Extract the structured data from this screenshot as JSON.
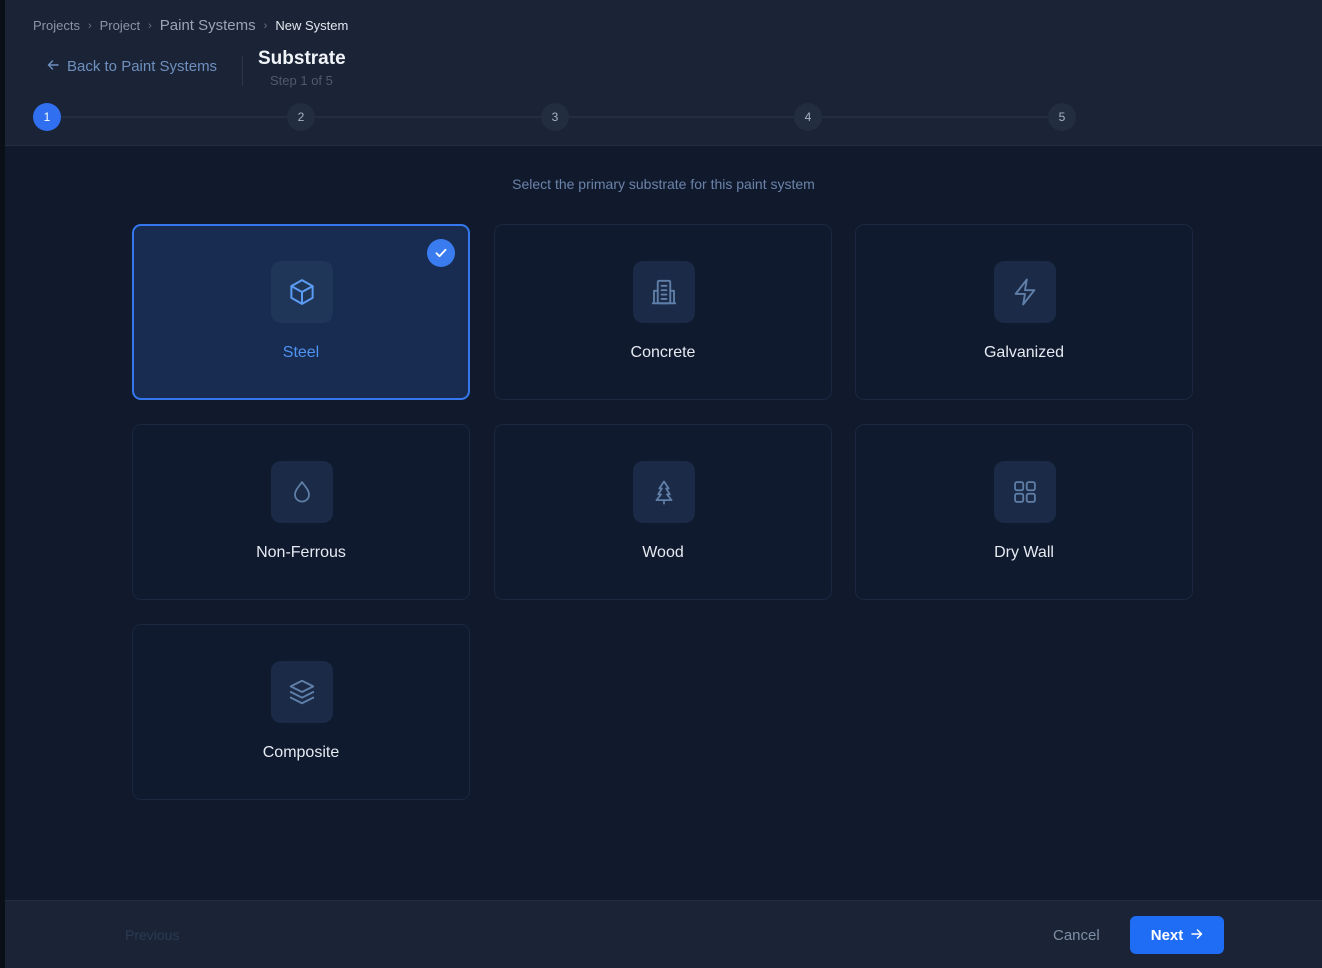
{
  "breadcrumb": {
    "items": [
      "Projects",
      "Project",
      "Paint Systems",
      "New System"
    ],
    "separator": "›"
  },
  "header": {
    "back_label": "Back to Paint Systems",
    "title": "Substrate",
    "subtitle": "Step 1 of 5"
  },
  "stepper": {
    "steps": [
      "1",
      "2",
      "3",
      "4",
      "5"
    ],
    "current": 1
  },
  "main": {
    "instruction": "Select the primary substrate for this paint system",
    "selected": "Steel",
    "options": [
      {
        "label": "Steel",
        "icon": "cube-icon"
      },
      {
        "label": "Concrete",
        "icon": "building-icon"
      },
      {
        "label": "Galvanized",
        "icon": "lightning-icon"
      },
      {
        "label": "Non-Ferrous",
        "icon": "droplet-icon"
      },
      {
        "label": "Wood",
        "icon": "tree-icon"
      },
      {
        "label": "Dry Wall",
        "icon": "grid-icon"
      },
      {
        "label": "Composite",
        "icon": "layers-icon"
      }
    ]
  },
  "footer": {
    "previous_label": "Previous",
    "cancel_label": "Cancel",
    "next_label": "Next"
  },
  "colors": {
    "accent": "#1f6cf5",
    "selected_border": "#3577ee",
    "selected_label": "#4f93f3",
    "background": "#111a2c",
    "header_background": "#1a2436"
  }
}
